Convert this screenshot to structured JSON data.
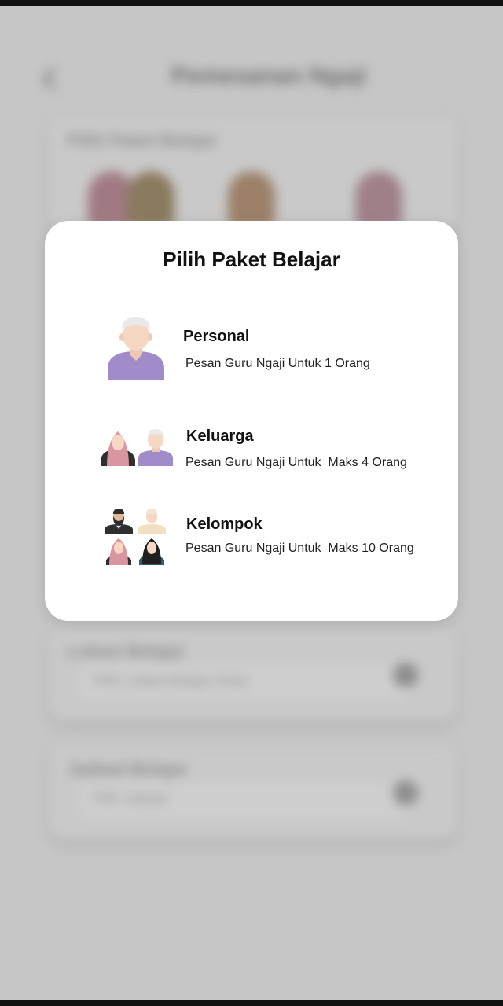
{
  "background": {
    "title": "Pemesanan Ngaji",
    "section1_label": "Pilih Paket Belajar",
    "section2_label": "Lokasi Belajar",
    "section2_value": "Pilih Lokasi Belajar Anda",
    "section3_label": "Jadwal Belajar",
    "section3_value": "Pilih Jadwal"
  },
  "modal": {
    "title": "Pilih Paket Belajar",
    "options": [
      {
        "id": "personal",
        "title": "Personal",
        "description": "Pesan Guru Ngaji Untuk 1 Orang",
        "icon": "single-man-icon"
      },
      {
        "id": "keluarga",
        "title": "Keluarga",
        "description": "Pesan Guru Ngaji Untuk  Maks 4 Orang",
        "icon": "family-icon"
      },
      {
        "id": "kelompok",
        "title": "Kelompok",
        "description": "Pesan Guru Ngaji Untuk  Maks 10 Orang",
        "icon": "group-icon"
      }
    ]
  },
  "colors": {
    "overlay": "#c6c6c6",
    "modal_bg": "#ffffff",
    "purple_shirt": "#a08cc8",
    "skin": "#f5d2be",
    "cap": "#ececec"
  }
}
